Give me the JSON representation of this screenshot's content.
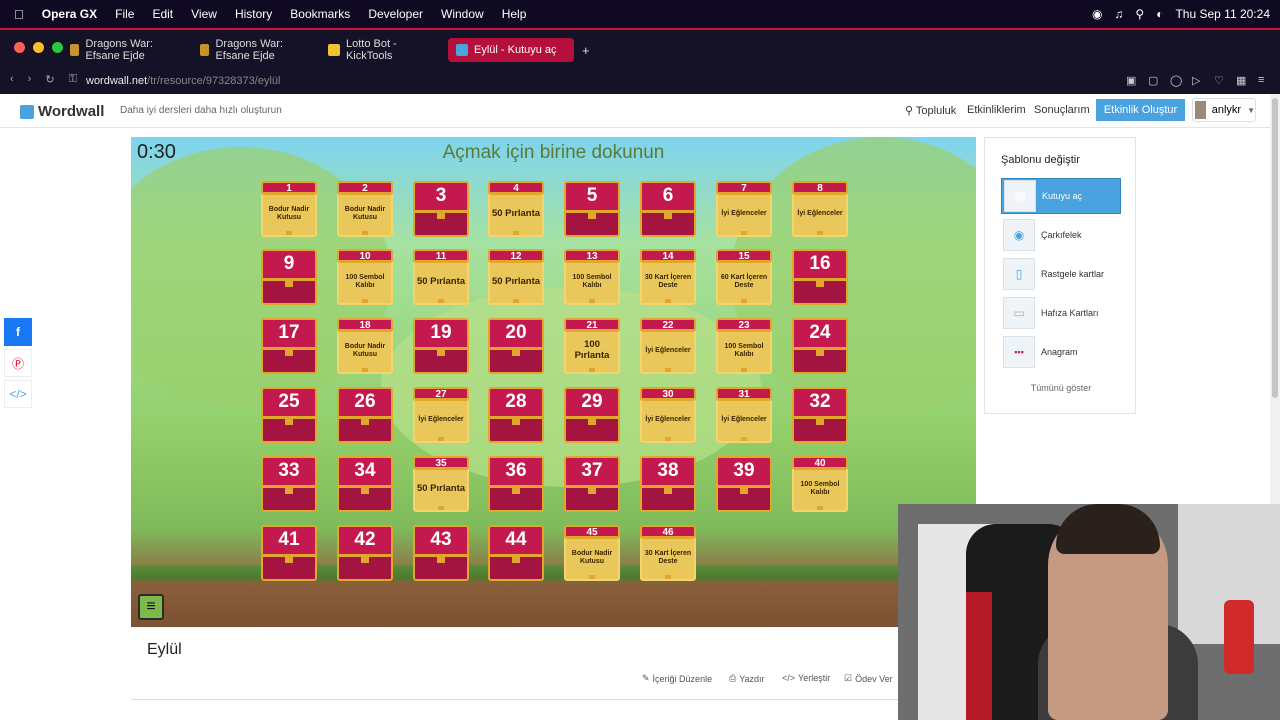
{
  "menubar": {
    "app": "Opera GX",
    "items": [
      "File",
      "Edit",
      "View",
      "History",
      "Bookmarks",
      "Developer",
      "Window",
      "Help"
    ],
    "clock": "Thu Sep 11  20:24"
  },
  "tabs": [
    {
      "label": "Dragons War: Efsane Ejde",
      "color": "#c9932c"
    },
    {
      "label": "Dragons War: Efsane Ejde",
      "color": "#c9932c"
    },
    {
      "label": "Lotto Bot - KickTools",
      "color": "#f2c12e"
    },
    {
      "label": "Eylül - Kutuyu aç",
      "color": "#4aa3df"
    }
  ],
  "address": {
    "host": "wordwall.net",
    "path": "/tr/resource/97328373/eylül"
  },
  "site": {
    "logo": "Wordwall",
    "tagline": "Daha iyi dersleri daha hızlı oluşturun",
    "nav": [
      "Topluluk",
      "Etkinliklerim",
      "Sonuçlarım"
    ],
    "create": "Etkinlik Oluştur",
    "user": "anlykr"
  },
  "game": {
    "timer": "0:30",
    "prompt": "Açmak için birine dokunun",
    "boxes": [
      {
        "n": "1",
        "open": true,
        "text": "Bodur Nadir Kutusu"
      },
      {
        "n": "2",
        "open": true,
        "text": "Bodur Nadir Kutusu"
      },
      {
        "n": "3",
        "open": false
      },
      {
        "n": "4",
        "open": true,
        "text": "50 Pırlanta",
        "big": true
      },
      {
        "n": "5",
        "open": false
      },
      {
        "n": "6",
        "open": false
      },
      {
        "n": "7",
        "open": true,
        "text": "İyi Eğlenceler"
      },
      {
        "n": "8",
        "open": true,
        "text": "İyi Eğlenceler"
      },
      {
        "n": "9",
        "open": false
      },
      {
        "n": "10",
        "open": true,
        "text": "100 Sembol Kalıbı"
      },
      {
        "n": "11",
        "open": true,
        "text": "50 Pırlanta",
        "big": true
      },
      {
        "n": "12",
        "open": true,
        "text": "50 Pırlanta",
        "big": true
      },
      {
        "n": "13",
        "open": true,
        "text": "100 Sembol Kalıbı"
      },
      {
        "n": "14",
        "open": true,
        "text": "30 Kart İçeren Deste"
      },
      {
        "n": "15",
        "open": true,
        "text": "60 Kart İçeren Deste"
      },
      {
        "n": "16",
        "open": false
      },
      {
        "n": "17",
        "open": false
      },
      {
        "n": "18",
        "open": true,
        "text": "Bodur Nadir Kutusu"
      },
      {
        "n": "19",
        "open": false
      },
      {
        "n": "20",
        "open": false
      },
      {
        "n": "21",
        "open": true,
        "text": "100 Pırlanta",
        "big": true
      },
      {
        "n": "22",
        "open": true,
        "text": "İyi Eğlenceler"
      },
      {
        "n": "23",
        "open": true,
        "text": "100 Sembol Kalıbı"
      },
      {
        "n": "24",
        "open": false
      },
      {
        "n": "25",
        "open": false
      },
      {
        "n": "26",
        "open": false
      },
      {
        "n": "27",
        "open": true,
        "text": "İyi Eğlenceler"
      },
      {
        "n": "28",
        "open": false
      },
      {
        "n": "29",
        "open": false
      },
      {
        "n": "30",
        "open": true,
        "text": "İyi Eğlenceler"
      },
      {
        "n": "31",
        "open": true,
        "text": "İyi Eğlenceler"
      },
      {
        "n": "32",
        "open": false
      },
      {
        "n": "33",
        "open": false
      },
      {
        "n": "34",
        "open": false
      },
      {
        "n": "35",
        "open": true,
        "text": "50 Pırlanta",
        "big": true
      },
      {
        "n": "36",
        "open": false
      },
      {
        "n": "37",
        "open": false
      },
      {
        "n": "38",
        "open": false
      },
      {
        "n": "39",
        "open": false
      },
      {
        "n": "40",
        "open": true,
        "text": "100 Sembol Kalıbı"
      },
      {
        "n": "41",
        "open": false
      },
      {
        "n": "42",
        "open": false
      },
      {
        "n": "43",
        "open": false
      },
      {
        "n": "44",
        "open": false
      },
      {
        "n": "45",
        "open": true,
        "text": "Bodur Nadir Kutusu"
      },
      {
        "n": "46",
        "open": true,
        "text": "30 Kart İçeren Deste"
      }
    ]
  },
  "panel": {
    "title": "Şablonu değiştir",
    "templates": [
      "Kutuyu aç",
      "Çarkıfelek",
      "Rastgele kartlar",
      "Hafıza Kartları",
      "Anagram"
    ],
    "show_all": "Tümünü göster"
  },
  "resource": {
    "title": "Eylül",
    "actions": [
      "İçeriği Düzenle",
      "Yazdır",
      "Yerleştir",
      "Ödev Ver"
    ]
  }
}
